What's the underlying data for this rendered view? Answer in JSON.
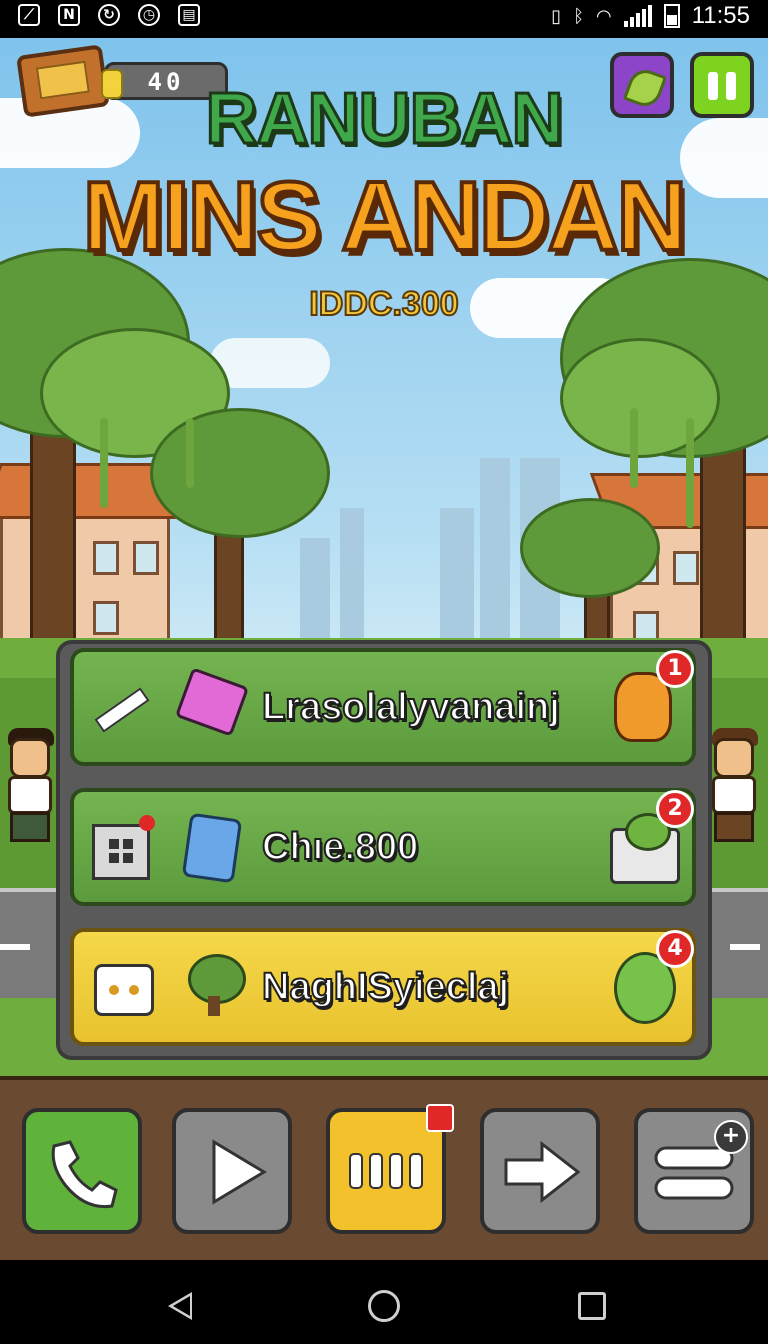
{
  "status_bar": {
    "time": "11:55",
    "left_icons": [
      "slash-icon",
      "n-icon",
      "sync-icon",
      "clock-icon",
      "sim-icon"
    ],
    "right_icons": [
      "vibrate-icon",
      "bluetooth-icon",
      "wifi-icon",
      "signal-icon",
      "battery-icon"
    ]
  },
  "header": {
    "coin_count": "40",
    "title_top": "RANUBAN",
    "title_main": "MINS ANDAN",
    "subtitle": "IDDC.300"
  },
  "menu": {
    "items": [
      {
        "label": "Lrasolalyvanainj",
        "badge": "1",
        "left_icon": "sparkle-arrow-icon",
        "mid_icon": "pink-gem-icon",
        "right_icon": "orange-creature-icon",
        "color": "#5c9b3c"
      },
      {
        "label": "Chıe.800",
        "badge": "2",
        "left_icon": "window-icon",
        "mid_icon": "blue-jar-icon",
        "right_icon": "green-bush-block-icon",
        "color": "#5c9b3c"
      },
      {
        "label": "NaghISyieclaj",
        "badge": "4",
        "left_icon": "robot-box-icon",
        "mid_icon": "tree-icon",
        "right_icon": "green-apple-icon",
        "color": "#e8c22e"
      }
    ]
  },
  "toolbar": {
    "buttons": [
      {
        "name": "phone-button",
        "icon": "phone-icon",
        "color": "#5fb23a"
      },
      {
        "name": "play-button",
        "icon": "play-icon",
        "color": "#8a8a8a"
      },
      {
        "name": "menu-bars-button",
        "icon": "bars-icon",
        "color": "#f2c12c"
      },
      {
        "name": "arrow-right-button",
        "icon": "arrow-right-icon",
        "color": "#8a8a8a"
      },
      {
        "name": "list-add-button",
        "icon": "list-icon",
        "color": "#8a8a8a"
      }
    ]
  },
  "colors": {
    "accent_green": "#5c9b3c",
    "accent_yellow": "#e8c22e",
    "title_orange": "#f6a21e",
    "badge_red": "#e02828"
  }
}
